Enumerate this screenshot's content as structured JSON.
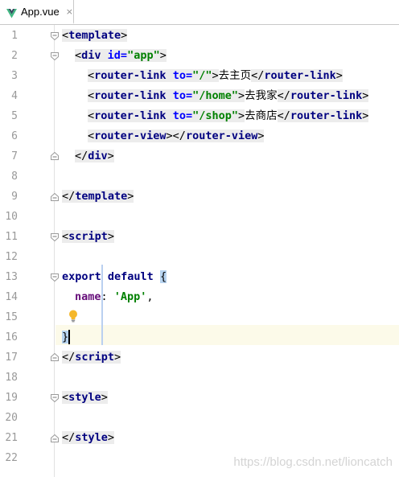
{
  "tab": {
    "title": "App.vue",
    "close": "×"
  },
  "watermark": "https://blog.csdn.net/lioncatch",
  "lines": [
    {
      "n": "1"
    },
    {
      "n": "2"
    },
    {
      "n": "3"
    },
    {
      "n": "4"
    },
    {
      "n": "5"
    },
    {
      "n": "6"
    },
    {
      "n": "7"
    },
    {
      "n": "8"
    },
    {
      "n": "9"
    },
    {
      "n": "10"
    },
    {
      "n": "11"
    },
    {
      "n": "12"
    },
    {
      "n": "13"
    },
    {
      "n": "14"
    },
    {
      "n": "15"
    },
    {
      "n": "16"
    },
    {
      "n": "17"
    },
    {
      "n": "18"
    },
    {
      "n": "19"
    },
    {
      "n": "20"
    },
    {
      "n": "21"
    },
    {
      "n": "22"
    }
  ],
  "code": {
    "template_open": "template",
    "div_tag": "div",
    "id_attr": "id=",
    "id_val": "\"app\"",
    "router_link": "router-link",
    "to_attr": "to=",
    "to_root": "\"/\"",
    "to_home": "\"/home\"",
    "to_shop": "\"/shop\"",
    "text_home": "去主页",
    "text_mine": "去我家",
    "text_shop": "去商店",
    "router_view": "router-view",
    "script": "script",
    "style": "style",
    "export_default": "export default",
    "brace_open": "{",
    "brace_close": "}",
    "name_key": "name",
    "name_val": "'App'"
  },
  "colors": {
    "tag": "#000080",
    "attr": "#0000ff",
    "string": "#008000",
    "property": "#660e7a",
    "current_line": "#fcfae9"
  }
}
